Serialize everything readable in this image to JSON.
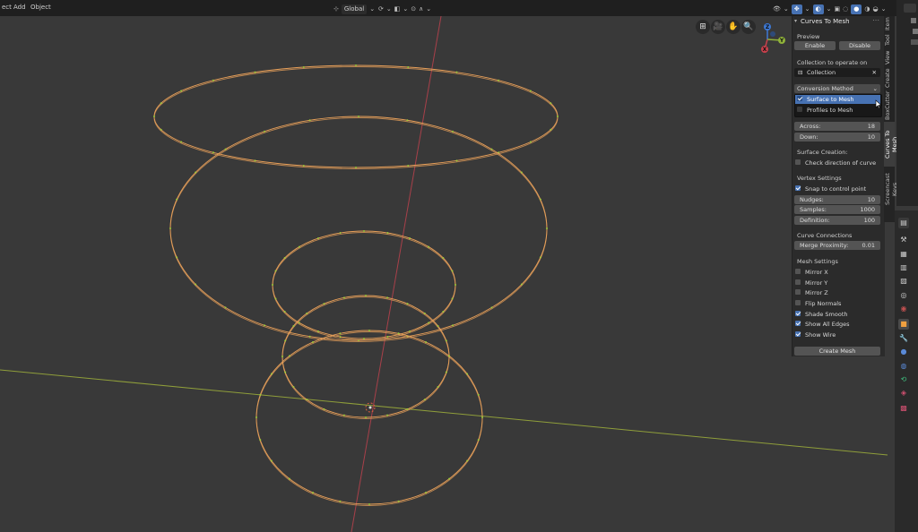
{
  "topbar": {
    "menus": [
      "ect",
      "Add",
      "Object"
    ],
    "orientation": "Global"
  },
  "panel": {
    "title": "Curves To Mesh",
    "preview": {
      "heading": "Preview",
      "enable": "Enable",
      "disable": "Disable"
    },
    "collection": {
      "heading": "Collection to operate on",
      "value": "Collection"
    },
    "conversion": {
      "label": "Conversion Method",
      "options": [
        "Surface to Mesh",
        "Profiles to Mesh"
      ],
      "selected": "Surface to Mesh"
    },
    "fields1": [
      {
        "label": "Across:",
        "value": "18"
      },
      {
        "label": "Down:",
        "value": "10"
      }
    ],
    "surface": {
      "heading": "Surface Creation:",
      "check": "Check direction of curve",
      "checked": false
    },
    "vertex": {
      "heading": "Vertex Settings",
      "snap": "Snap to control point",
      "snap_checked": true,
      "fields": [
        {
          "label": "Nudges:",
          "value": "10"
        },
        {
          "label": "Samples:",
          "value": "1000"
        },
        {
          "label": "Definition:",
          "value": "100"
        }
      ]
    },
    "curve_conn": {
      "heading": "Curve Connections",
      "label": "Merge Proximity:",
      "value": "0.01"
    },
    "mesh": {
      "heading": "Mesh Settings",
      "items": [
        {
          "label": "Mirror X",
          "checked": false
        },
        {
          "label": "Mirror Y",
          "checked": false
        },
        {
          "label": "Mirror Z",
          "checked": false
        },
        {
          "label": "Flip Normals",
          "checked": false
        },
        {
          "label": "Shade Smooth",
          "checked": true
        },
        {
          "label": "Show All Edges",
          "checked": true
        },
        {
          "label": "Show Wire",
          "checked": true
        }
      ],
      "create": "Create Mesh"
    }
  },
  "tabs": [
    "Item",
    "Tool",
    "View",
    "Create",
    "BoxCutter",
    "Curves To Mesh",
    "Screencast Keys"
  ],
  "active_tab": "Curves To Mesh",
  "gizmo": {
    "x": "X",
    "y": "Y",
    "z": "Z"
  },
  "colors": {
    "viewport_bg": "#393939",
    "curve": "#e8a05a",
    "vertex": "#9ccc3a",
    "x_axis": "#a4c23a",
    "y_axis": "#c0404a",
    "accent": "#4772b3"
  }
}
